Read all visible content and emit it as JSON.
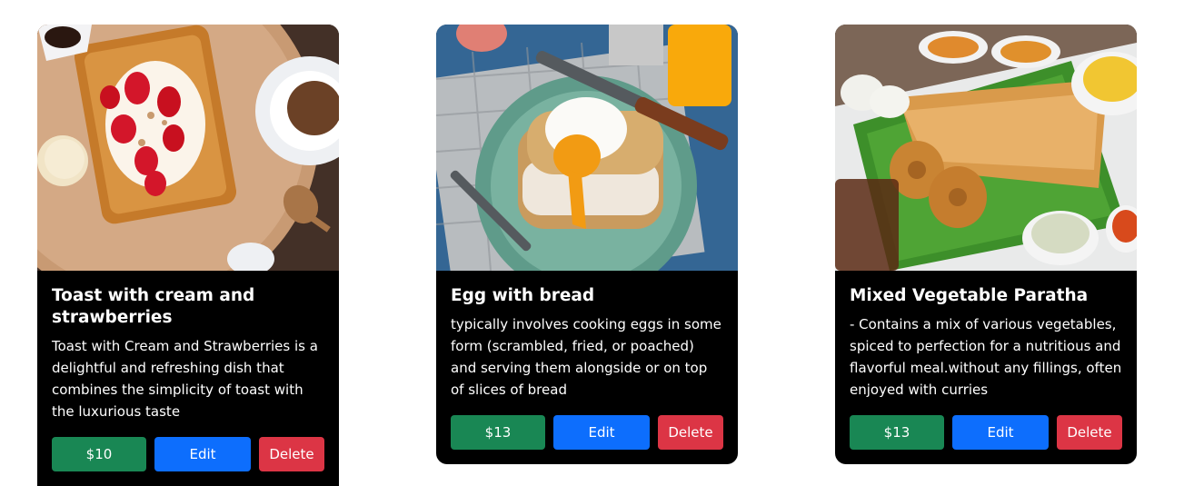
{
  "cards": [
    {
      "title": "Toast with cream and strawberries",
      "description": "Toast with Cream and Strawberries is a delightful and refreshing dish that combines the simplicity of toast with the luxurious taste",
      "price": "$10",
      "edit_label": "Edit",
      "delete_label": "Delete",
      "image_icon": "waffle-strawberries-photo"
    },
    {
      "title": "Egg with bread",
      "description": "typically involves cooking eggs in some form (scrambled, fried, or poached) and serving them alongside or on top of slices of bread",
      "price": "$13",
      "edit_label": "Edit",
      "delete_label": "Delete",
      "image_icon": "egg-toast-photo"
    },
    {
      "title": "Mixed Vegetable Paratha",
      "description": "- Contains a mix of various vegetables, spiced to perfection for a nutritious and flavorful meal.without any fillings, often enjoyed with curries",
      "price": "$13",
      "edit_label": "Edit",
      "delete_label": "Delete",
      "image_icon": "dosa-platter-photo"
    }
  ],
  "colors": {
    "card_bg": "#000000",
    "price_button": "#198754",
    "edit_button": "#0d6efd",
    "delete_button": "#dc3545"
  }
}
